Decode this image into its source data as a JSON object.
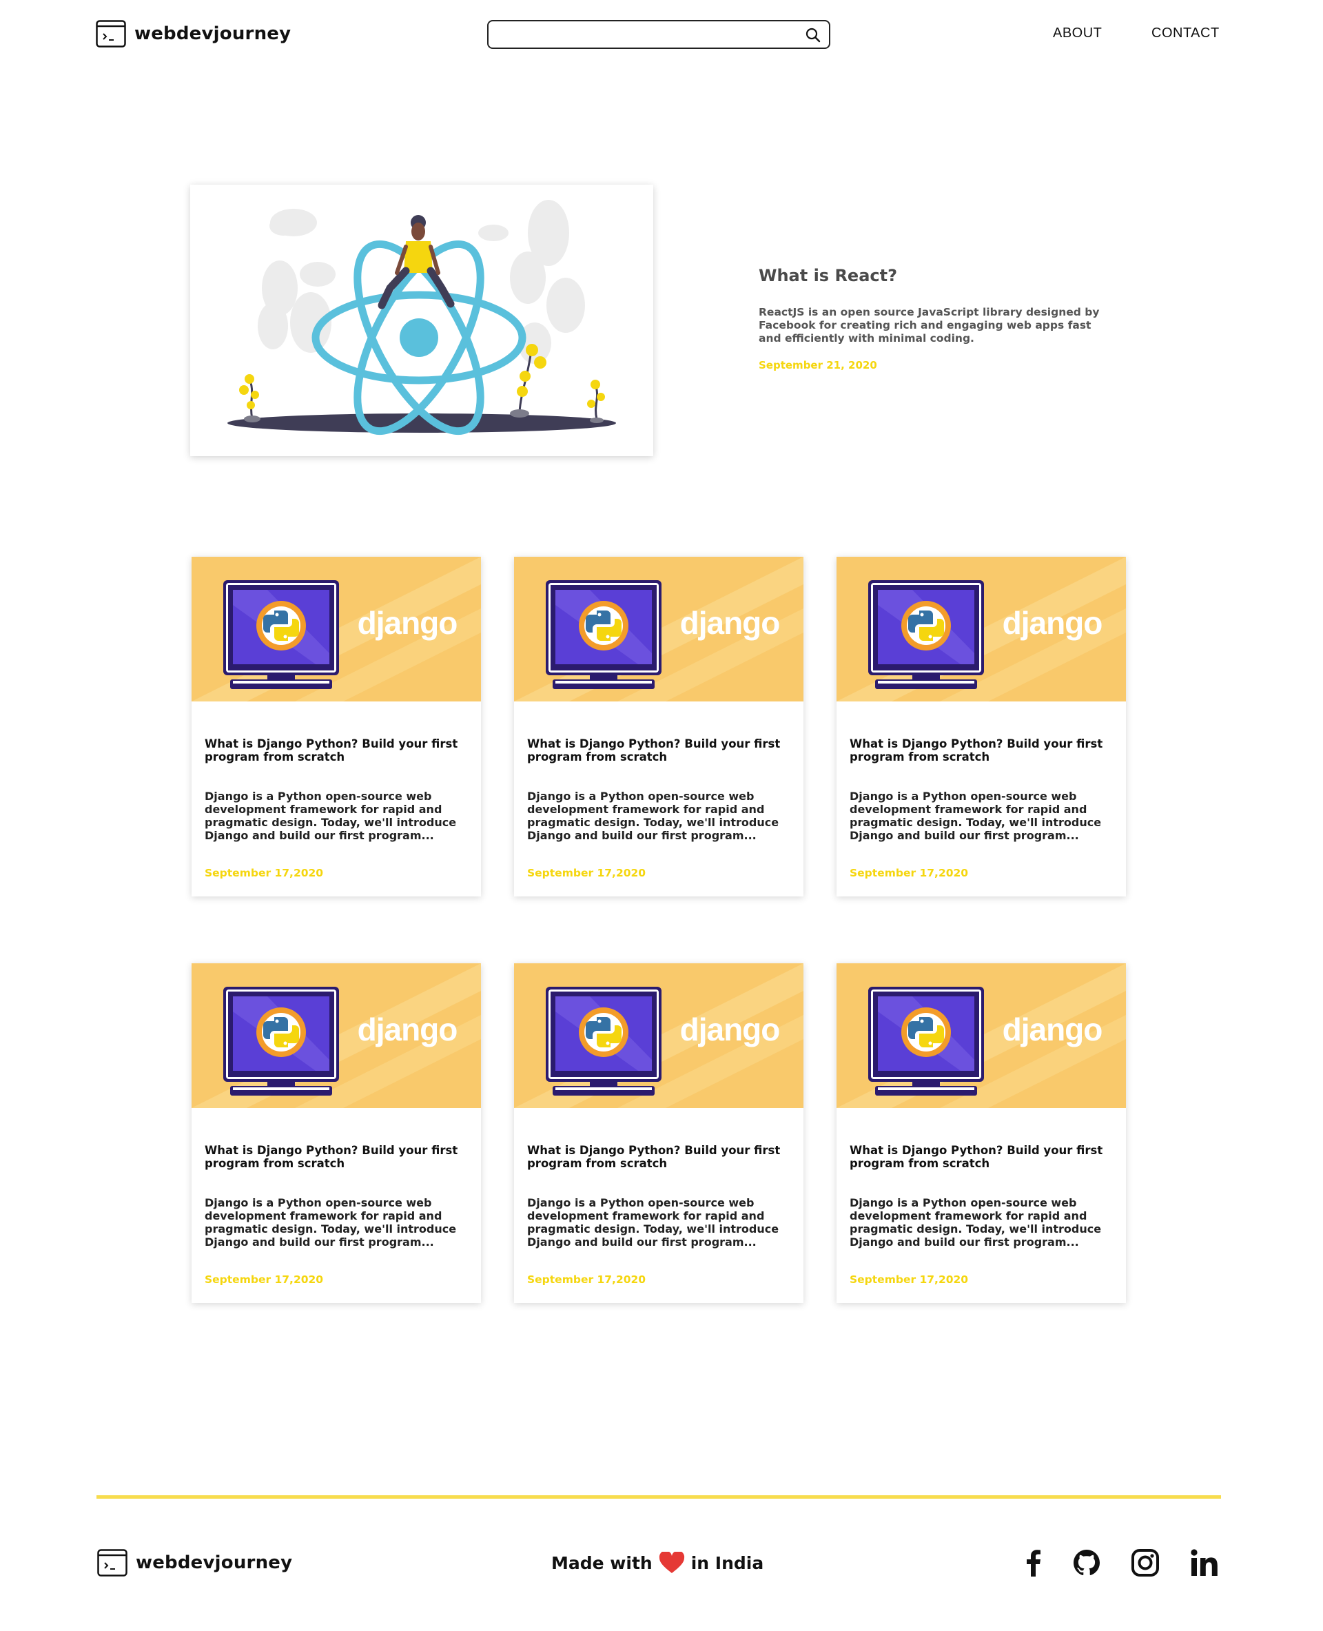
{
  "header": {
    "brand": "webdevjourney",
    "search_placeholder": "",
    "nav": {
      "about": "ABOUT",
      "contact": "CONTACT"
    }
  },
  "featured": {
    "title": "What is React?",
    "description": "ReactJS is an open source JavaScript library designed by Facebook for creating rich and engaging web apps fast and efficiently with minimal coding.",
    "date": "September 21, 2020"
  },
  "cards": [
    {
      "image_text": "django",
      "title": "What is Django Python? Build your first program from scratch",
      "description": "Django is a Python open-source web development framework for rapid and pragmatic design. Today, we'll introduce Django and build our first program...",
      "date": "September 17,2020"
    },
    {
      "image_text": "django",
      "title": "What is Django Python? Build your first program from scratch",
      "description": "Django is a Python open-source web development framework for rapid and pragmatic design. Today, we'll introduce Django and build our first program...",
      "date": "September 17,2020"
    },
    {
      "image_text": "django",
      "title": "What is Django Python? Build your first program from scratch",
      "description": "Django is a Python open-source web development framework for rapid and pragmatic design. Today, we'll introduce Django and build our first program...",
      "date": "September 17,2020"
    },
    {
      "image_text": "django",
      "title": "What is Django Python? Build your first program from scratch",
      "description": "Django is a Python open-source web development framework for rapid and pragmatic design. Today, we'll introduce Django and build our first program...",
      "date": "September 17,2020"
    },
    {
      "image_text": "django",
      "title": "What is Django Python? Build your first program from scratch",
      "description": "Django is a Python open-source web development framework for rapid and pragmatic design. Today, we'll introduce Django and build our first program...",
      "date": "September 17,2020"
    },
    {
      "image_text": "django",
      "title": "What is Django Python? Build your first program from scratch",
      "description": "Django is a Python open-source web development framework for rapid and pragmatic design. Today, we'll introduce Django and build our first program...",
      "date": "September 17,2020"
    }
  ],
  "footer": {
    "brand": "webdevjourney",
    "made_prefix": "Made with",
    "made_suffix": "in India",
    "social_icons": [
      "facebook-icon",
      "github-icon",
      "instagram-icon",
      "linkedin-icon"
    ]
  },
  "colors": {
    "accent_yellow": "#f5d60f",
    "footer_line": "#f7dc4d",
    "card_banner": "#f9c96b",
    "react_blue": "#5ac0dc",
    "monitor_purple": "#2b1b6e",
    "heart_red": "#e53935"
  }
}
